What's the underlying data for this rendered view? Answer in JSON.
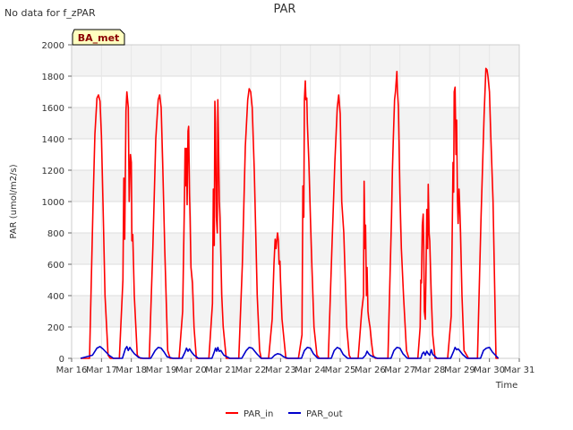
{
  "header": {
    "note": "No data for f_zPAR",
    "site_badge": "BA_met"
  },
  "chart_data": {
    "type": "line",
    "title": "PAR",
    "xlabel": "Time",
    "ylabel": "PAR (umol/m2/s)",
    "xlim": [
      16,
      31
    ],
    "ylim": [
      0,
      2000
    ],
    "yticks": [
      0,
      200,
      400,
      600,
      800,
      1000,
      1200,
      1400,
      1600,
      1800,
      2000
    ],
    "xticks": [
      {
        "day": 16,
        "label": "Mar 16"
      },
      {
        "day": 17,
        "label": "Mar 17"
      },
      {
        "day": 18,
        "label": "Mar 18"
      },
      {
        "day": 19,
        "label": "Mar 19"
      },
      {
        "day": 20,
        "label": "Mar 20"
      },
      {
        "day": 21,
        "label": "Mar 21"
      },
      {
        "day": 22,
        "label": "Mar 22"
      },
      {
        "day": 23,
        "label": "Mar 23"
      },
      {
        "day": 24,
        "label": "Mar 24"
      },
      {
        "day": 25,
        "label": "Mar 25"
      },
      {
        "day": 26,
        "label": "Mar 26"
      },
      {
        "day": 27,
        "label": "Mar 27"
      },
      {
        "day": 28,
        "label": "Mar 28"
      },
      {
        "day": 29,
        "label": "Mar 29"
      },
      {
        "day": 30,
        "label": "Mar 30"
      },
      {
        "day": 31,
        "label": "Mar 31"
      }
    ],
    "grid": true,
    "legend_position": "bottom-center",
    "series": [
      {
        "name": "PAR_in",
        "color": "#ff0000",
        "x": [
          16.3,
          16.6,
          16.72,
          16.78,
          16.85,
          16.9,
          16.95,
          17.0,
          17.05,
          17.12,
          17.22,
          17.3,
          17.35,
          17.6,
          17.72,
          17.75,
          17.78,
          17.82,
          17.85,
          17.9,
          17.93,
          17.97,
          18.0,
          18.02,
          18.05,
          18.1,
          18.2,
          18.3,
          18.6,
          18.72,
          18.82,
          18.9,
          18.95,
          19.0,
          19.05,
          19.12,
          19.22,
          19.3,
          19.35,
          19.6,
          19.72,
          19.78,
          19.8,
          19.82,
          19.85,
          19.87,
          19.9,
          19.92,
          19.95,
          19.97,
          20.0,
          20.02,
          20.05,
          20.1,
          20.18,
          20.3,
          20.6,
          20.72,
          20.75,
          20.78,
          20.8,
          20.82,
          20.85,
          20.88,
          20.9,
          20.92,
          20.95,
          20.97,
          21.0,
          21.03,
          21.08,
          21.18,
          21.3,
          21.6,
          21.72,
          21.82,
          21.9,
          21.95,
          22.0,
          22.05,
          22.12,
          22.22,
          22.3,
          22.35,
          22.6,
          22.72,
          22.78,
          22.82,
          22.85,
          22.88,
          22.9,
          22.93,
          22.95,
          22.98,
          23.0,
          23.05,
          23.1,
          23.18,
          23.6,
          23.72,
          23.75,
          23.78,
          23.8,
          23.83,
          23.85,
          23.88,
          23.9,
          23.95,
          24.0,
          24.05,
          24.12,
          24.22,
          24.3,
          24.6,
          24.72,
          24.82,
          24.9,
          24.95,
          25.0,
          25.05,
          25.12,
          25.22,
          25.3,
          25.35,
          25.6,
          25.72,
          25.78,
          25.8,
          25.83,
          25.85,
          25.88,
          25.9,
          25.93,
          25.95,
          25.98,
          26.0,
          26.05,
          26.1,
          26.18,
          26.6,
          26.72,
          26.75,
          26.78,
          26.82,
          26.85,
          26.9,
          26.92,
          26.95,
          27.0,
          27.05,
          27.12,
          27.22,
          27.3,
          27.6,
          27.68,
          27.7,
          27.72,
          27.75,
          27.78,
          27.8,
          27.82,
          27.85,
          27.87,
          27.9,
          27.93,
          27.95,
          27.98,
          28.0,
          28.05,
          28.1,
          28.18,
          28.6,
          28.72,
          28.78,
          28.8,
          28.82,
          28.85,
          28.88,
          28.9,
          28.93,
          28.95,
          28.98,
          29.0,
          29.03,
          29.08,
          29.15,
          29.3,
          29.6,
          29.72,
          29.82,
          29.88,
          29.92,
          29.95,
          30.0,
          30.05,
          30.12,
          30.22,
          30.3
        ],
        "y": [
          0,
          0,
          1000,
          1430,
          1660,
          1680,
          1640,
          1420,
          1000,
          400,
          20,
          0,
          0,
          0,
          500,
          1150,
          760,
          1580,
          1700,
          1600,
          1000,
          1300,
          1250,
          750,
          790,
          400,
          20,
          0,
          0,
          700,
          1400,
          1650,
          1680,
          1600,
          1250,
          700,
          50,
          0,
          0,
          0,
          300,
          1000,
          1340,
          1100,
          1340,
          980,
          1450,
          1480,
          1050,
          900,
          580,
          540,
          480,
          200,
          0,
          0,
          0,
          350,
          1080,
          720,
          1640,
          1500,
          900,
          800,
          1650,
          1400,
          1000,
          900,
          650,
          400,
          200,
          0,
          0,
          0,
          600,
          1350,
          1650,
          1720,
          1700,
          1600,
          1200,
          400,
          50,
          0,
          0,
          250,
          600,
          760,
          700,
          760,
          800,
          750,
          600,
          620,
          500,
          250,
          150,
          0,
          0,
          150,
          1100,
          900,
          1650,
          1770,
          1650,
          1660,
          1500,
          1250,
          900,
          600,
          200,
          20,
          0,
          0,
          700,
          1250,
          1600,
          1680,
          1560,
          1000,
          800,
          200,
          20,
          0,
          0,
          300,
          400,
          1130,
          700,
          850,
          400,
          580,
          300,
          260,
          220,
          200,
          100,
          20,
          0,
          0,
          900,
          1200,
          1400,
          1650,
          1700,
          1830,
          1700,
          1600,
          1050,
          700,
          400,
          50,
          0,
          0,
          200,
          500,
          480,
          850,
          920,
          700,
          300,
          250,
          500,
          950,
          700,
          1110,
          800,
          750,
          400,
          150,
          0,
          0,
          270,
          1250,
          1060,
          1700,
          1730,
          1300,
          1520,
          1000,
          860,
          1080,
          1000,
          820,
          400,
          50,
          0,
          0,
          900,
          1550,
          1850,
          1840,
          1800,
          1700,
          1400,
          1000,
          0,
          0
        ]
      },
      {
        "name": "PAR_out",
        "color": "#0000cc",
        "x": [
          16.3,
          16.7,
          16.85,
          16.95,
          17.05,
          17.25,
          17.4,
          17.7,
          17.8,
          17.85,
          17.9,
          17.95,
          18.0,
          18.1,
          18.25,
          18.4,
          18.65,
          18.8,
          18.9,
          19.0,
          19.1,
          19.2,
          19.4,
          19.7,
          19.8,
          19.85,
          19.9,
          19.95,
          20.0,
          20.1,
          20.25,
          20.7,
          20.78,
          20.82,
          20.86,
          20.9,
          20.94,
          21.0,
          21.1,
          21.3,
          21.7,
          21.85,
          21.95,
          22.05,
          22.2,
          22.35,
          22.7,
          22.8,
          22.9,
          23.0,
          23.1,
          23.25,
          23.7,
          23.8,
          23.9,
          24.0,
          24.1,
          24.25,
          24.7,
          24.8,
          24.9,
          25.0,
          25.1,
          25.25,
          25.75,
          25.85,
          25.9,
          25.95,
          26.0,
          26.1,
          26.25,
          26.7,
          26.8,
          26.9,
          27.0,
          27.1,
          27.25,
          27.7,
          27.75,
          27.8,
          27.85,
          27.9,
          27.95,
          28.0,
          28.05,
          28.1,
          28.25,
          28.7,
          28.8,
          28.85,
          28.9,
          28.95,
          29.0,
          29.1,
          29.25,
          29.7,
          29.8,
          29.9,
          30.0,
          30.1,
          30.3
        ],
        "y": [
          0,
          20,
          65,
          75,
          60,
          20,
          0,
          0,
          60,
          75,
          50,
          70,
          55,
          30,
          5,
          0,
          0,
          50,
          70,
          65,
          40,
          10,
          0,
          0,
          40,
          65,
          45,
          60,
          45,
          20,
          0,
          0,
          40,
          65,
          45,
          70,
          45,
          50,
          20,
          0,
          0,
          50,
          70,
          65,
          30,
          0,
          0,
          20,
          30,
          25,
          10,
          0,
          0,
          50,
          70,
          65,
          30,
          0,
          0,
          50,
          70,
          60,
          25,
          0,
          0,
          20,
          45,
          30,
          20,
          10,
          0,
          0,
          50,
          70,
          65,
          30,
          0,
          0,
          30,
          40,
          20,
          45,
          30,
          20,
          55,
          25,
          0,
          0,
          45,
          70,
          55,
          60,
          50,
          25,
          0,
          0,
          50,
          65,
          70,
          40,
          0
        ]
      }
    ]
  }
}
